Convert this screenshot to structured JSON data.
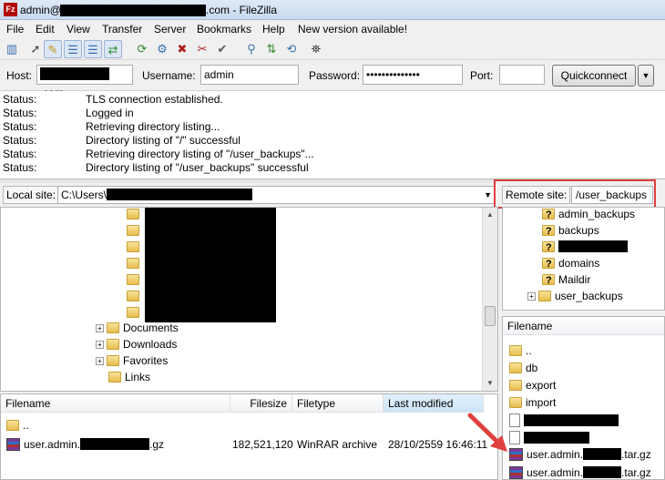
{
  "window": {
    "title_prefix": "admin@",
    "title_suffix": ".com - FileZilla",
    "app_icon": "filezilla-icon"
  },
  "menu": [
    "File",
    "Edit",
    "View",
    "Transfer",
    "Server",
    "Bookmarks",
    "Help",
    "New version available!"
  ],
  "connection": {
    "host_label": "Host:",
    "host_suffix": ".com",
    "username_label": "Username:",
    "username_value": "admin",
    "password_label": "Password:",
    "password_value": "••••••••••••••",
    "port_label": "Port:",
    "port_value": "",
    "quickconnect": "Quickconnect"
  },
  "log": [
    {
      "k": "Status:",
      "v": "TLS connection established."
    },
    {
      "k": "Status:",
      "v": "Logged in"
    },
    {
      "k": "Status:",
      "v": "Retrieving directory listing..."
    },
    {
      "k": "Status:",
      "v": "Directory listing of \"/\" successful"
    },
    {
      "k": "Status:",
      "v": "Retrieving directory listing of \"/user_backups\"..."
    },
    {
      "k": "Status:",
      "v": "Directory listing of \"/user_backups\" successful"
    }
  ],
  "local": {
    "site_label": "Local site:",
    "path_prefix": "C:\\Users\\",
    "tree": [
      "Documents",
      "Downloads",
      "Favorites",
      "Links"
    ],
    "columns": [
      "Filename",
      "Filesize",
      "Filetype",
      "Last modified"
    ],
    "files": [
      {
        "name": "..",
        "size": "",
        "type": "",
        "modified": ""
      },
      {
        "name_prefix": "user.admin.",
        "name_suffix": ".gz",
        "size": "182,521,120",
        "type": "WinRAR archive",
        "modified": "28/10/2559 16:46:11"
      }
    ]
  },
  "remote": {
    "site_label": "Remote site:",
    "path": "/user_backups",
    "tree": [
      "admin_backups",
      "backups",
      "domains",
      "Maildir",
      "user_backups"
    ],
    "columns": [
      "Filename"
    ],
    "files": [
      {
        "name": ".."
      },
      {
        "name": "db"
      },
      {
        "name": "export"
      },
      {
        "name": "import"
      },
      {
        "name_prefix": "user.admin.",
        "name_suffix": ".tar.gz"
      },
      {
        "name_prefix": "user.admin.",
        "name_suffix": ".tar.gz"
      }
    ]
  },
  "colors": {
    "highlight_box": "#e04040",
    "arrow": "#e04040"
  }
}
